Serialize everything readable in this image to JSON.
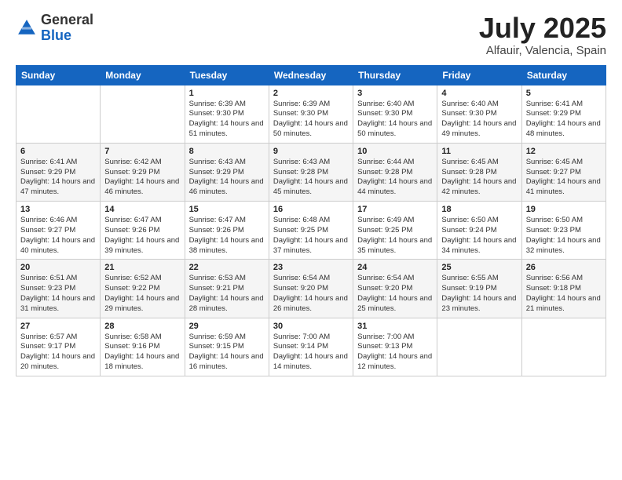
{
  "header": {
    "logo_general": "General",
    "logo_blue": "Blue",
    "title": "July 2025",
    "location": "Alfauir, Valencia, Spain"
  },
  "days_of_week": [
    "Sunday",
    "Monday",
    "Tuesday",
    "Wednesday",
    "Thursday",
    "Friday",
    "Saturday"
  ],
  "weeks": [
    [
      {
        "num": "",
        "info": ""
      },
      {
        "num": "",
        "info": ""
      },
      {
        "num": "1",
        "info": "Sunrise: 6:39 AM\nSunset: 9:30 PM\nDaylight: 14 hours and 51 minutes."
      },
      {
        "num": "2",
        "info": "Sunrise: 6:39 AM\nSunset: 9:30 PM\nDaylight: 14 hours and 50 minutes."
      },
      {
        "num": "3",
        "info": "Sunrise: 6:40 AM\nSunset: 9:30 PM\nDaylight: 14 hours and 50 minutes."
      },
      {
        "num": "4",
        "info": "Sunrise: 6:40 AM\nSunset: 9:30 PM\nDaylight: 14 hours and 49 minutes."
      },
      {
        "num": "5",
        "info": "Sunrise: 6:41 AM\nSunset: 9:29 PM\nDaylight: 14 hours and 48 minutes."
      }
    ],
    [
      {
        "num": "6",
        "info": "Sunrise: 6:41 AM\nSunset: 9:29 PM\nDaylight: 14 hours and 47 minutes."
      },
      {
        "num": "7",
        "info": "Sunrise: 6:42 AM\nSunset: 9:29 PM\nDaylight: 14 hours and 46 minutes."
      },
      {
        "num": "8",
        "info": "Sunrise: 6:43 AM\nSunset: 9:29 PM\nDaylight: 14 hours and 46 minutes."
      },
      {
        "num": "9",
        "info": "Sunrise: 6:43 AM\nSunset: 9:28 PM\nDaylight: 14 hours and 45 minutes."
      },
      {
        "num": "10",
        "info": "Sunrise: 6:44 AM\nSunset: 9:28 PM\nDaylight: 14 hours and 44 minutes."
      },
      {
        "num": "11",
        "info": "Sunrise: 6:45 AM\nSunset: 9:28 PM\nDaylight: 14 hours and 42 minutes."
      },
      {
        "num": "12",
        "info": "Sunrise: 6:45 AM\nSunset: 9:27 PM\nDaylight: 14 hours and 41 minutes."
      }
    ],
    [
      {
        "num": "13",
        "info": "Sunrise: 6:46 AM\nSunset: 9:27 PM\nDaylight: 14 hours and 40 minutes."
      },
      {
        "num": "14",
        "info": "Sunrise: 6:47 AM\nSunset: 9:26 PM\nDaylight: 14 hours and 39 minutes."
      },
      {
        "num": "15",
        "info": "Sunrise: 6:47 AM\nSunset: 9:26 PM\nDaylight: 14 hours and 38 minutes."
      },
      {
        "num": "16",
        "info": "Sunrise: 6:48 AM\nSunset: 9:25 PM\nDaylight: 14 hours and 37 minutes."
      },
      {
        "num": "17",
        "info": "Sunrise: 6:49 AM\nSunset: 9:25 PM\nDaylight: 14 hours and 35 minutes."
      },
      {
        "num": "18",
        "info": "Sunrise: 6:50 AM\nSunset: 9:24 PM\nDaylight: 14 hours and 34 minutes."
      },
      {
        "num": "19",
        "info": "Sunrise: 6:50 AM\nSunset: 9:23 PM\nDaylight: 14 hours and 32 minutes."
      }
    ],
    [
      {
        "num": "20",
        "info": "Sunrise: 6:51 AM\nSunset: 9:23 PM\nDaylight: 14 hours and 31 minutes."
      },
      {
        "num": "21",
        "info": "Sunrise: 6:52 AM\nSunset: 9:22 PM\nDaylight: 14 hours and 29 minutes."
      },
      {
        "num": "22",
        "info": "Sunrise: 6:53 AM\nSunset: 9:21 PM\nDaylight: 14 hours and 28 minutes."
      },
      {
        "num": "23",
        "info": "Sunrise: 6:54 AM\nSunset: 9:20 PM\nDaylight: 14 hours and 26 minutes."
      },
      {
        "num": "24",
        "info": "Sunrise: 6:54 AM\nSunset: 9:20 PM\nDaylight: 14 hours and 25 minutes."
      },
      {
        "num": "25",
        "info": "Sunrise: 6:55 AM\nSunset: 9:19 PM\nDaylight: 14 hours and 23 minutes."
      },
      {
        "num": "26",
        "info": "Sunrise: 6:56 AM\nSunset: 9:18 PM\nDaylight: 14 hours and 21 minutes."
      }
    ],
    [
      {
        "num": "27",
        "info": "Sunrise: 6:57 AM\nSunset: 9:17 PM\nDaylight: 14 hours and 20 minutes."
      },
      {
        "num": "28",
        "info": "Sunrise: 6:58 AM\nSunset: 9:16 PM\nDaylight: 14 hours and 18 minutes."
      },
      {
        "num": "29",
        "info": "Sunrise: 6:59 AM\nSunset: 9:15 PM\nDaylight: 14 hours and 16 minutes."
      },
      {
        "num": "30",
        "info": "Sunrise: 7:00 AM\nSunset: 9:14 PM\nDaylight: 14 hours and 14 minutes."
      },
      {
        "num": "31",
        "info": "Sunrise: 7:00 AM\nSunset: 9:13 PM\nDaylight: 14 hours and 12 minutes."
      },
      {
        "num": "",
        "info": ""
      },
      {
        "num": "",
        "info": ""
      }
    ]
  ]
}
